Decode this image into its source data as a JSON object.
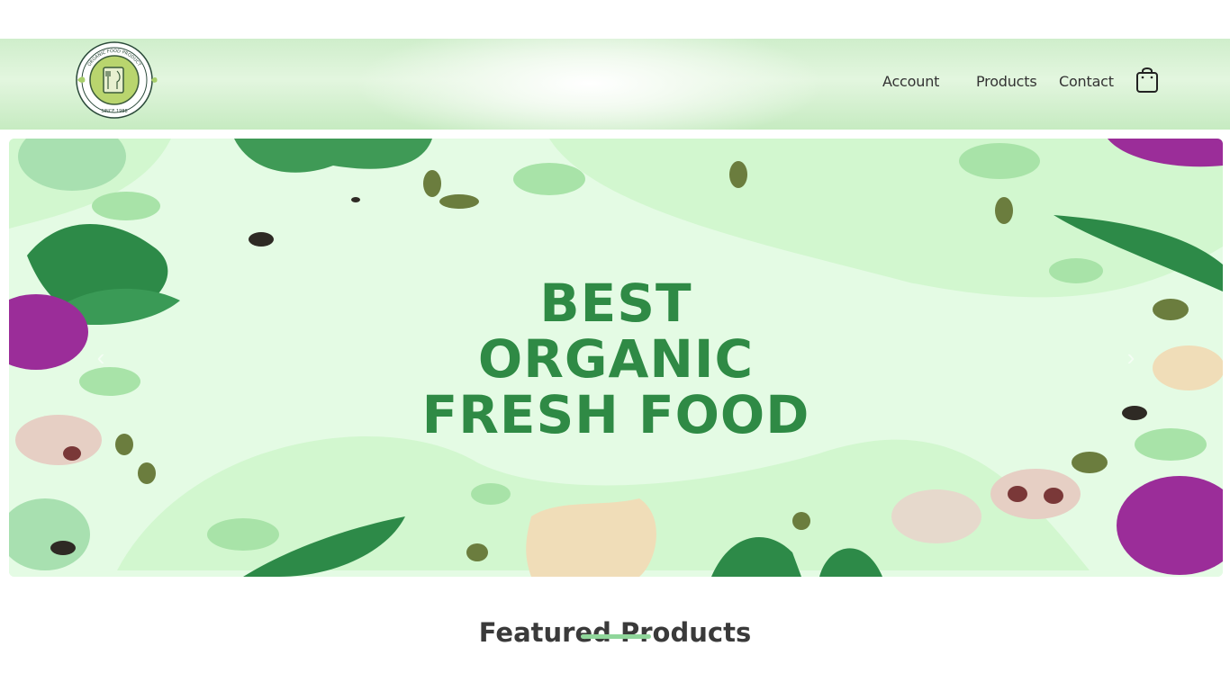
{
  "brand": {
    "logo_ring_text": "ORGANIC FOOD PRODUCT",
    "logo_since": "SINCE 1988"
  },
  "nav": {
    "links": [
      {
        "label": "Account"
      },
      {
        "label": "Products"
      },
      {
        "label": "Contact"
      }
    ],
    "cart_icon": "shopping-bag-icon"
  },
  "hero": {
    "lines": [
      "BEST",
      "ORGANIC",
      "FRESH FOOD"
    ],
    "prev_icon": "chevron-left-icon",
    "next_icon": "chevron-right-icon"
  },
  "featured": {
    "title": "Featured Products"
  },
  "colors": {
    "brand_green": "#2f8a45",
    "nav_bg": "#cfeecb",
    "hero_bg": "#e4fbe4",
    "accent_underline": "#8fd69a",
    "text_dark": "#333333"
  }
}
